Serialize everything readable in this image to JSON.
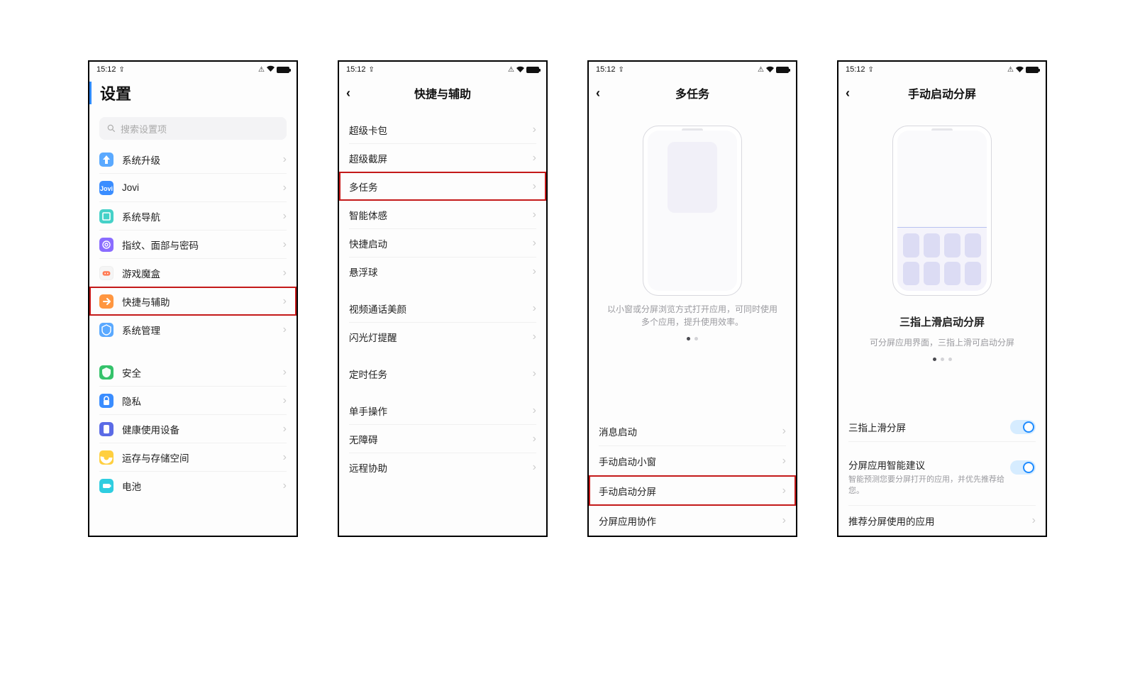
{
  "status": {
    "time": "15:12"
  },
  "screen1": {
    "title": "设置",
    "search_placeholder": "搜索设置项",
    "group1": [
      {
        "label": "系统升级",
        "icon": "upgrade",
        "color": "ic-lblue"
      },
      {
        "label": "Jovi",
        "icon": "jovi",
        "color": "ic-blue"
      },
      {
        "label": "系统导航",
        "icon": "nav",
        "color": "ic-teal"
      },
      {
        "label": "指纹、面部与密码",
        "icon": "bio",
        "color": "ic-purple"
      },
      {
        "label": "游戏魔盒",
        "icon": "game",
        "color": "ic-white"
      },
      {
        "label": "快捷与辅助",
        "icon": "shortcut",
        "color": "ic-orange",
        "hl": true
      },
      {
        "label": "系统管理",
        "icon": "system",
        "color": "ic-lblue"
      }
    ],
    "group2": [
      {
        "label": "安全",
        "icon": "shield",
        "color": "ic-green"
      },
      {
        "label": "隐私",
        "icon": "lock",
        "color": "ic-blue"
      },
      {
        "label": "健康使用设备",
        "icon": "health",
        "color": "ic-indigo"
      },
      {
        "label": "运存与存储空间",
        "icon": "storage",
        "color": "ic-yellow"
      },
      {
        "label": "电池",
        "icon": "battery",
        "color": "ic-cyan"
      }
    ]
  },
  "screen2": {
    "title": "快捷与辅助",
    "g1": [
      "超级卡包",
      "超级截屏",
      "多任务",
      "智能体感",
      "快捷启动",
      "悬浮球"
    ],
    "g2": [
      "视频通话美颜",
      "闪光灯提醒"
    ],
    "g3": [
      "定时任务"
    ],
    "g4": [
      "单手操作",
      "无障碍",
      "远程协助"
    ],
    "hl_index": 2
  },
  "screen3": {
    "title": "多任务",
    "desc": "以小窗或分屏浏览方式打开应用，可同时使用多个应用，提升使用效率。",
    "items": [
      "消息启动",
      "手动启动小窗",
      "手动启动分屏",
      "分屏应用协作"
    ],
    "hl_index": 2
  },
  "screen4": {
    "title": "手动启动分屏",
    "caption": "三指上滑启动分屏",
    "sub": "可分屏应用界面，三指上滑可启动分屏",
    "rows": {
      "r1": "三指上滑分屏",
      "r2_title": "分屏应用智能建议",
      "r2_sub": "智能预测您要分屏打开的应用，并优先推荐给您。",
      "r3": "推荐分屏使用的应用"
    }
  }
}
